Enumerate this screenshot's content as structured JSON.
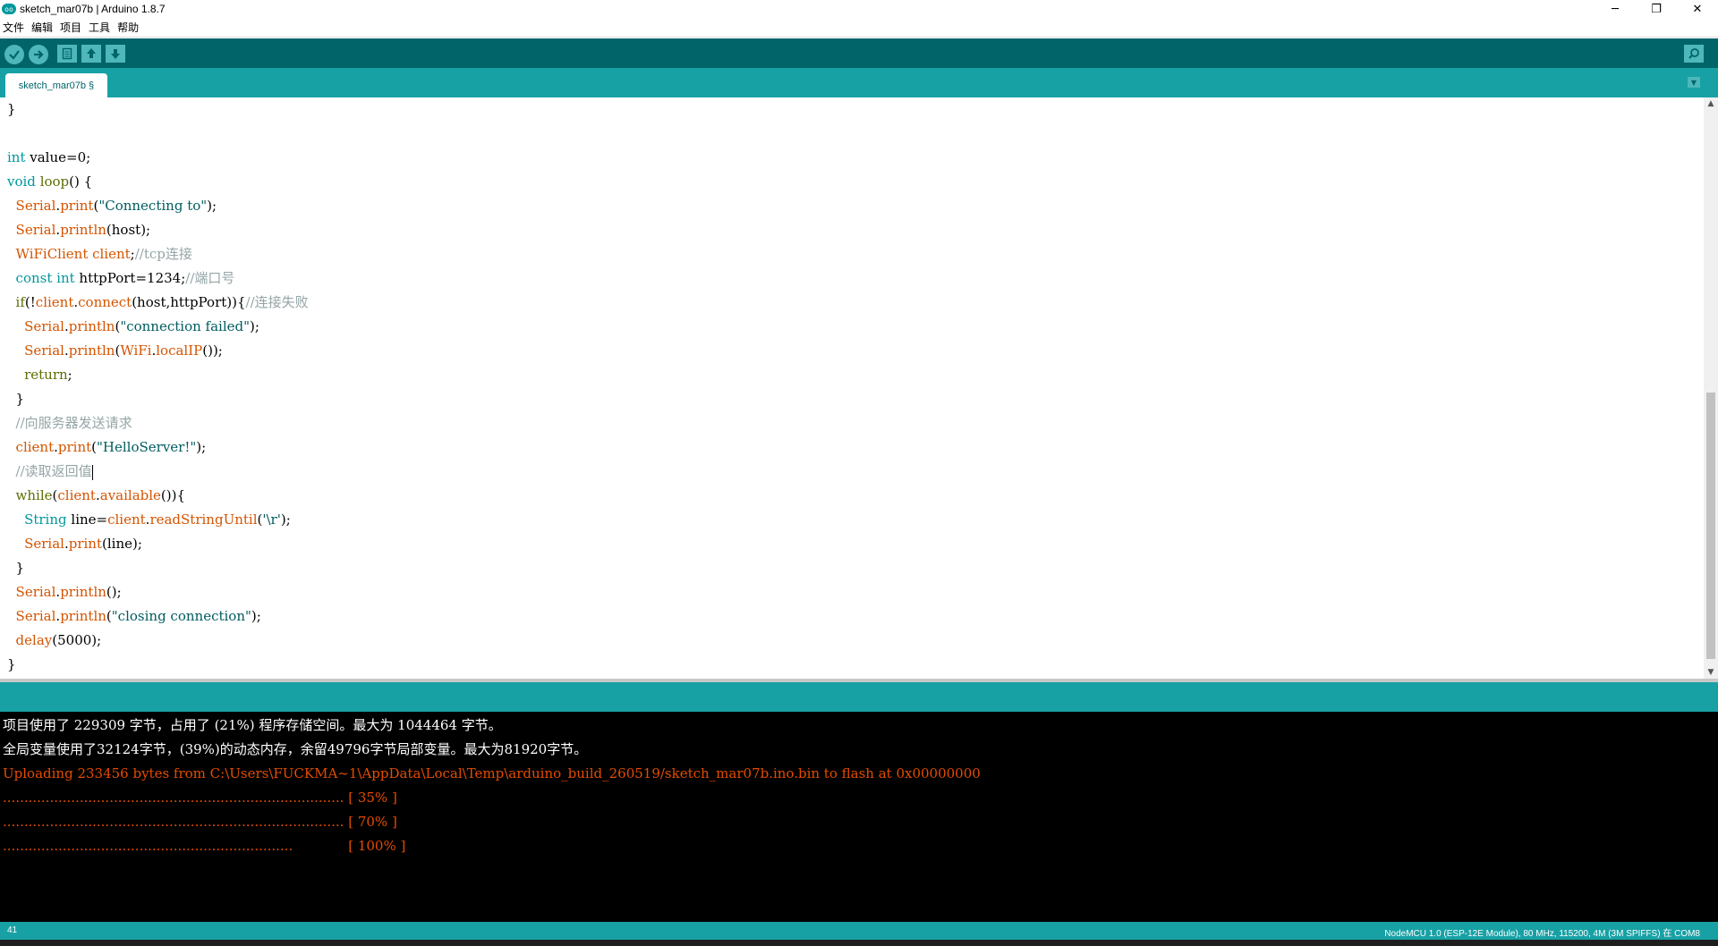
{
  "window": {
    "title": "sketch_mar07b | Arduino 1.8.7",
    "logo_text": "oo",
    "controls": [
      "─",
      "❐",
      "✕"
    ]
  },
  "menu": [
    "文件",
    "编辑",
    "项目",
    "工具",
    "帮助"
  ],
  "toolbar": {
    "buttons": [
      "verify",
      "upload",
      "new",
      "open",
      "save"
    ],
    "icons": {
      "verify": "✓",
      "upload": "➜",
      "new": "▤",
      "open": "⬆",
      "save": "⬇",
      "serial_monitor": "⌕"
    }
  },
  "tabs": [
    {
      "label": "sketch_mar07b §"
    }
  ],
  "tab_menu_icon": "▼",
  "code": [
    [
      [
        "}",
        "#000000"
      ]
    ],
    [],
    [
      [
        "int",
        "#00979c"
      ],
      [
        " value=0;",
        "#000000"
      ]
    ],
    [
      [
        "void",
        "#00979c"
      ],
      [
        " ",
        "#000000"
      ],
      [
        "loop",
        "#5e6d03"
      ],
      [
        "() {",
        "#000000"
      ]
    ],
    [
      [
        "  ",
        "#000000"
      ],
      [
        "Serial",
        "#d35400"
      ],
      [
        ".",
        "#000000"
      ],
      [
        "print",
        "#d35400"
      ],
      [
        "(",
        "#000000"
      ],
      [
        "\"Connecting to\"",
        "#005c5f"
      ],
      [
        ");",
        "#000000"
      ]
    ],
    [
      [
        "  ",
        "#000000"
      ],
      [
        "Serial",
        "#d35400"
      ],
      [
        ".",
        "#000000"
      ],
      [
        "println",
        "#d35400"
      ],
      [
        "(host);",
        "#000000"
      ]
    ],
    [
      [
        "  ",
        "#000000"
      ],
      [
        "WiFiClient client",
        "#d35400"
      ],
      [
        ";",
        "#000000"
      ],
      [
        "//tcp连接",
        "#95a5a6"
      ]
    ],
    [
      [
        "  ",
        "#000000"
      ],
      [
        "const",
        "#00979c"
      ],
      [
        " ",
        "#000000"
      ],
      [
        "int",
        "#00979c"
      ],
      [
        " httpPort=1234;",
        "#000000"
      ],
      [
        "//端口号",
        "#95a5a6"
      ]
    ],
    [
      [
        "  ",
        "#000000"
      ],
      [
        "if",
        "#5e6d03"
      ],
      [
        "(!",
        "#000000"
      ],
      [
        "client",
        "#d35400"
      ],
      [
        ".",
        "#000000"
      ],
      [
        "connect",
        "#d35400"
      ],
      [
        "(host,httpPort)){",
        "#000000"
      ],
      [
        "//连接失败",
        "#95a5a6"
      ]
    ],
    [
      [
        "    ",
        "#000000"
      ],
      [
        "Serial",
        "#d35400"
      ],
      [
        ".",
        "#000000"
      ],
      [
        "println",
        "#d35400"
      ],
      [
        "(",
        "#000000"
      ],
      [
        "\"connection failed\"",
        "#005c5f"
      ],
      [
        ");",
        "#000000"
      ]
    ],
    [
      [
        "    ",
        "#000000"
      ],
      [
        "Serial",
        "#d35400"
      ],
      [
        ".",
        "#000000"
      ],
      [
        "println",
        "#d35400"
      ],
      [
        "(",
        "#000000"
      ],
      [
        "WiFi",
        "#d35400"
      ],
      [
        ".",
        "#000000"
      ],
      [
        "localIP",
        "#d35400"
      ],
      [
        "());",
        "#000000"
      ]
    ],
    [
      [
        "    ",
        "#000000"
      ],
      [
        "return",
        "#5e6d03"
      ],
      [
        ";",
        "#000000"
      ]
    ],
    [
      [
        "  }",
        "#000000"
      ]
    ],
    [
      [
        "  ",
        "#000000"
      ],
      [
        "//向服务器发送请求",
        "#95a5a6"
      ]
    ],
    [
      [
        "  ",
        "#000000"
      ],
      [
        "client",
        "#d35400"
      ],
      [
        ".",
        "#000000"
      ],
      [
        "print",
        "#d35400"
      ],
      [
        "(",
        "#000000"
      ],
      [
        "\"HelloServer!\"",
        "#005c5f"
      ],
      [
        ");",
        "#000000"
      ]
    ],
    [
      [
        "  ",
        "#000000"
      ],
      [
        "//读取返回值",
        "#95a5a6"
      ]
    ],
    [
      [
        "  ",
        "#000000"
      ],
      [
        "while",
        "#5e6d03"
      ],
      [
        "(",
        "#000000"
      ],
      [
        "client",
        "#d35400"
      ],
      [
        ".",
        "#000000"
      ],
      [
        "available",
        "#d35400"
      ],
      [
        "()){",
        "#000000"
      ]
    ],
    [
      [
        "    ",
        "#000000"
      ],
      [
        "String",
        "#00979c"
      ],
      [
        " line=",
        "#000000"
      ],
      [
        "client",
        "#d35400"
      ],
      [
        ".",
        "#000000"
      ],
      [
        "readStringUntil",
        "#d35400"
      ],
      [
        "(",
        "#000000"
      ],
      [
        "'\\r'",
        "#005c5f"
      ],
      [
        ");",
        "#000000"
      ]
    ],
    [
      [
        "    ",
        "#000000"
      ],
      [
        "Serial",
        "#d35400"
      ],
      [
        ".",
        "#000000"
      ],
      [
        "print",
        "#d35400"
      ],
      [
        "(line);",
        "#000000"
      ]
    ],
    [
      [
        "  }",
        "#000000"
      ]
    ],
    [
      [
        "  ",
        "#000000"
      ],
      [
        "Serial",
        "#d35400"
      ],
      [
        ".",
        "#000000"
      ],
      [
        "println",
        "#d35400"
      ],
      [
        "();",
        "#000000"
      ]
    ],
    [
      [
        "  ",
        "#000000"
      ],
      [
        "Serial",
        "#d35400"
      ],
      [
        ".",
        "#000000"
      ],
      [
        "println",
        "#d35400"
      ],
      [
        "(",
        "#000000"
      ],
      [
        "\"closing connection\"",
        "#005c5f"
      ],
      [
        ");",
        "#000000"
      ]
    ],
    [
      [
        "  ",
        "#000000"
      ],
      [
        "delay",
        "#d35400"
      ],
      [
        "(5000);",
        "#000000"
      ]
    ],
    [
      [
        "}",
        "#000000"
      ]
    ]
  ],
  "caret_line": 15,
  "console": [
    {
      "text": "项目使用了 229309 字节，占用了 (21%) 程序存储空间。最大为 1044464 字节。",
      "color": "#ffffff"
    },
    {
      "text": "全局变量使用了32124字节，(39%)的动态内存，余留49796字节局部变量。最大为81920字节。",
      "color": "#ffffff"
    },
    {
      "text": "Uploading 233456 bytes from C:\\Users\\FUCKMA~1\\AppData\\Local\\Temp\\arduino_build_260519/sketch_mar07b.ino.bin to flash at 0x00000000",
      "color": "#e34c00"
    },
    {
      "text": "................................................................................ [ 35% ]",
      "color": "#e34c00"
    },
    {
      "text": "................................................................................ [ 70% ]",
      "color": "#e34c00"
    },
    {
      "text": "....................................................................             [ 100% ]",
      "color": "#e34c00"
    }
  ],
  "footer": {
    "line_number": "41",
    "board_info": "NodeMCU 1.0 (ESP-12E Module), 80 MHz, 115200, 4M (3M SPIFFS) 在 COM8"
  },
  "colors": {
    "toolbar": "#006468",
    "tabbar": "#17a1a5",
    "button": "#4db7bb",
    "console_bg": "#000000"
  }
}
